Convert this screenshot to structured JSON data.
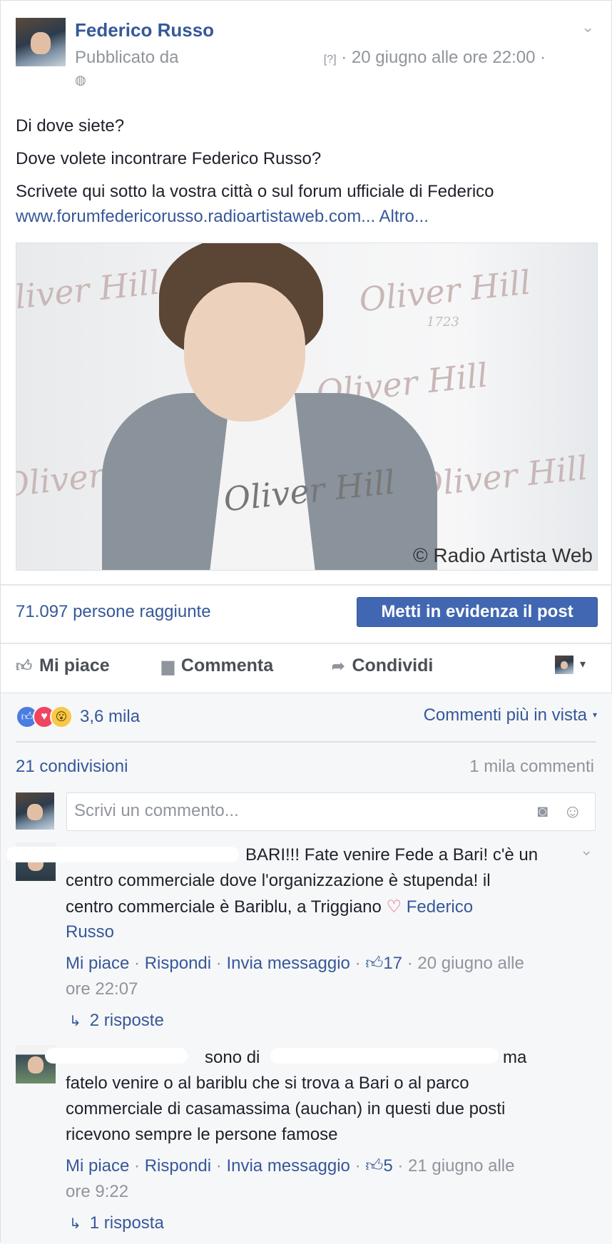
{
  "post": {
    "author": "Federico Russo",
    "meta_prefix": "Pubblicato da",
    "meta_q": "[?]",
    "meta_date": " · 20 giugno alle ore 22:00 ·",
    "lines": [
      "Di dove siete?",
      "Dove volete incontrare Federico Russo?",
      "Scrivete qui sotto la vostra città o sul forum ufficiale di Federico"
    ],
    "link": "www.forumfedericorusso.radioartistaweb.com...",
    "more": "Altro...",
    "photo_credit": "© Radio Artista Web",
    "watermark": "Oliver Hill",
    "watermark_year": "1723"
  },
  "reach": {
    "text": "71.097 persone raggiunte",
    "boost_label": "Metti in evidenza il post"
  },
  "actions": {
    "like": "Mi piace",
    "comment": "Commenta",
    "share": "Condividi"
  },
  "stats": {
    "reactions": "3,6 mila",
    "sort": "Commenti più in vista",
    "shares": "21 condivisioni",
    "comments": "1 mila commenti"
  },
  "composer": {
    "placeholder": "Scrivi un commento..."
  },
  "comments": [
    {
      "line1": "BARI!!! Fate venire Fede a Bari! c'è un",
      "line2": "centro commerciale dove l'organizzazione è stupenda! il",
      "line3": "centro commerciale è Bariblu, a Triggiano",
      "tag1": "Federico",
      "tag2": "Russo",
      "like": "Mi piace",
      "reply": "Rispondi",
      "message": "Invia messaggio",
      "likes": "17",
      "date1": "· 20 giugno alle",
      "date2": "ore 22:07",
      "replies": "2 risposte"
    },
    {
      "line1a": "sono di",
      "line1b": "ma",
      "line2": "fatelo venire o al bariblu che si trova a Bari o al parco",
      "line3": "commerciale di casamassima (auchan) in questi due posti",
      "line4": "ricevono sempre le persone famose",
      "like": "Mi piace",
      "reply": "Rispondi",
      "message": "Invia messaggio",
      "likes": "5",
      "date1": "· 21 giugno alle",
      "date2": "ore 9:22",
      "replies": "1 risposta"
    }
  ],
  "sep": "·",
  "colors": {
    "link": "#365899",
    "button": "#4267b2",
    "muted": "#90949c"
  }
}
